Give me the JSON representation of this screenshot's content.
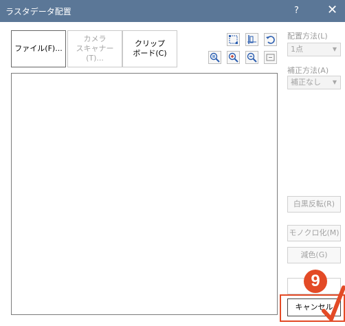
{
  "window": {
    "title": "ラスタデータ配置",
    "help": "?",
    "close": "✕"
  },
  "toolbar": {
    "file_label": "ファイル(F)...",
    "camera_line1": "カメラ",
    "camera_line2": "スキャナー(T)...",
    "clipboard_line1": "クリップ",
    "clipboard_line2": "ボード(C)"
  },
  "icons": [
    "fit-page-icon",
    "align-icon",
    "undo-icon",
    "zoom-fit-icon",
    "zoom-in-icon",
    "zoom-out-icon",
    "actual-size-icon"
  ],
  "layout": {
    "method_label": "配置方法(L)",
    "method_value": "1点"
  },
  "correction": {
    "label": "補正方法(A)",
    "value": "補正なし"
  },
  "side_buttons": {
    "invert": "白黒反転(R)",
    "mono": "モノクロ化(M)",
    "reduce": "減色(G)",
    "ok": "",
    "cancel": "キャンセル"
  },
  "callout": {
    "number": "9"
  },
  "colors": {
    "titlebar": "#5b7797",
    "callout": "#e34a26"
  }
}
